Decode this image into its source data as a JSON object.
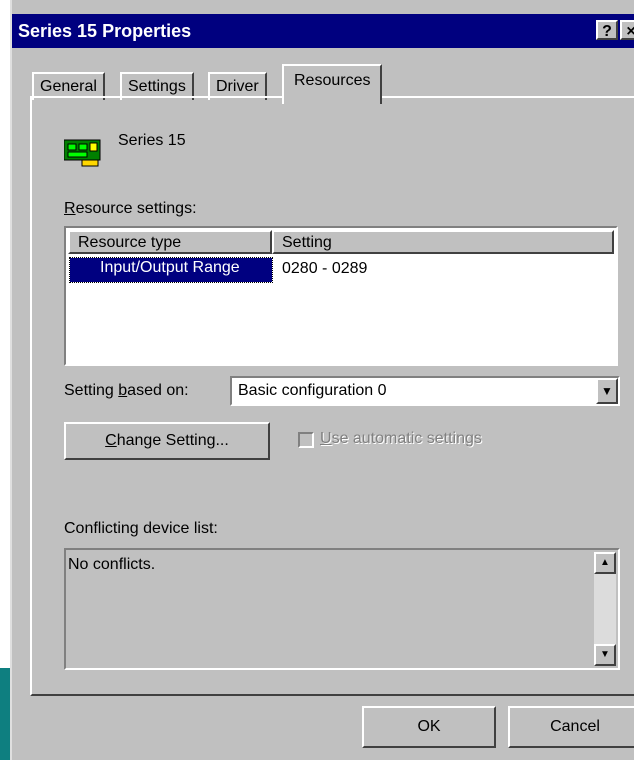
{
  "window": {
    "title": "Series 15 Properties",
    "help_button": "?",
    "close_button": "×"
  },
  "tabs": [
    {
      "label": "General",
      "active": false
    },
    {
      "label": "Settings",
      "active": false
    },
    {
      "label": "Driver",
      "active": false
    },
    {
      "label": "Resources",
      "active": true
    }
  ],
  "device": {
    "icon": "network-card-icon",
    "name": "Series 15"
  },
  "resource_settings": {
    "label_prefix": "",
    "label_mnemonic": "R",
    "label_rest": "esource settings:",
    "columns": [
      "Resource type",
      "Setting"
    ],
    "rows": [
      {
        "type": "Input/Output Range",
        "setting": "0280 - 0289",
        "selected": true
      }
    ]
  },
  "setting_based_on": {
    "label_prefix": "Setting ",
    "label_mnemonic": "b",
    "label_rest": "ased on:",
    "value": "Basic configuration 0"
  },
  "change_setting": {
    "mnemonic": "C",
    "rest": "hange Setting..."
  },
  "automatic": {
    "mnemonic": "U",
    "rest": "se automatic settings",
    "checked": false,
    "enabled": false
  },
  "conflicts": {
    "label": "Conflicting device list:",
    "text": "No conflicts."
  },
  "buttons": {
    "ok": "OK",
    "cancel": "Cancel"
  },
  "colors": {
    "title_bar": "#00007f",
    "selection": "#000080",
    "face": "#c0c0c0"
  }
}
